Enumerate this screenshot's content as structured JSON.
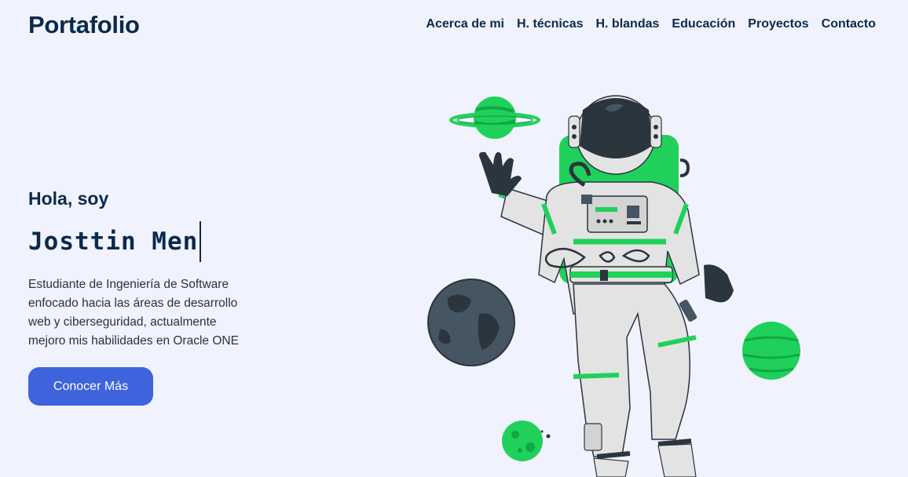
{
  "header": {
    "logo": "Portafolio",
    "nav": [
      {
        "label": "Acerca de mi"
      },
      {
        "label": "H. técnicas"
      },
      {
        "label": "H. blandas"
      },
      {
        "label": "Educación"
      },
      {
        "label": "Proyectos"
      },
      {
        "label": "Contacto"
      }
    ]
  },
  "hero": {
    "greeting": "Hola, soy",
    "name": "Josttin Men",
    "description": "Estudiante de Ingeniería de Software enfocado hacia las áreas de desarrollo web y ciberseguridad, actualmente mejoro mis habilidades en Oracle ONE",
    "cta_label": "Conocer Más"
  },
  "colors": {
    "background": "#f0f2fe",
    "text": "#0b2a4a",
    "accent": "#3f63dd",
    "illustration_green": "#1fd15a"
  }
}
